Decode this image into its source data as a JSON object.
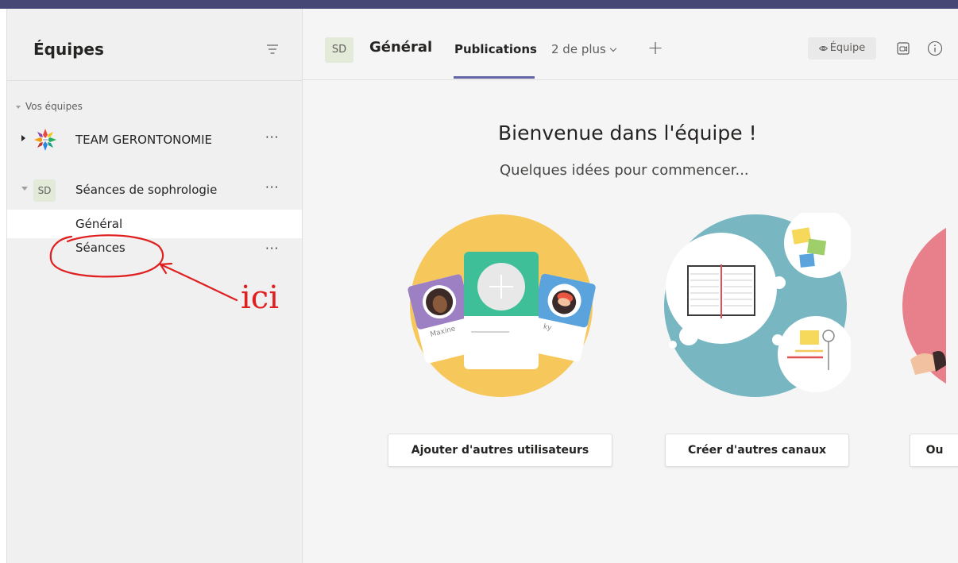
{
  "sidebar": {
    "title": "Équipes",
    "section_label": "Vos équipes",
    "teams": [
      {
        "name": "TEAM GERONTONOMIE",
        "more": "···"
      },
      {
        "name": "Séances de sophrologie",
        "avatar": "SD",
        "more": "···"
      }
    ],
    "channels": [
      {
        "name": "Général"
      },
      {
        "name": "Séances",
        "more": "···"
      }
    ]
  },
  "annotation": {
    "text": "ici",
    "color": "#e02020"
  },
  "header": {
    "avatar": "SD",
    "channel": "Général",
    "tabs": [
      {
        "label": "Publications",
        "active": true
      },
      {
        "label": "2 de plus"
      }
    ],
    "team_button": "Équipe",
    "add_tab_icon": "plus-icon",
    "meet_icon": "meet-camera-icon",
    "info_icon": "info-icon"
  },
  "welcome": {
    "title": "Bienvenue dans l'équipe !",
    "subtitle": "Quelques idées pour commencer...",
    "card_names": [
      "Maxine",
      "ky"
    ],
    "actions": [
      {
        "label": "Ajouter d'autres utilisateurs"
      },
      {
        "label": "Créer d'autres canaux"
      },
      {
        "label": "Ou"
      }
    ]
  },
  "colors": {
    "accent": "#6264a7",
    "topbar": "#464775"
  }
}
